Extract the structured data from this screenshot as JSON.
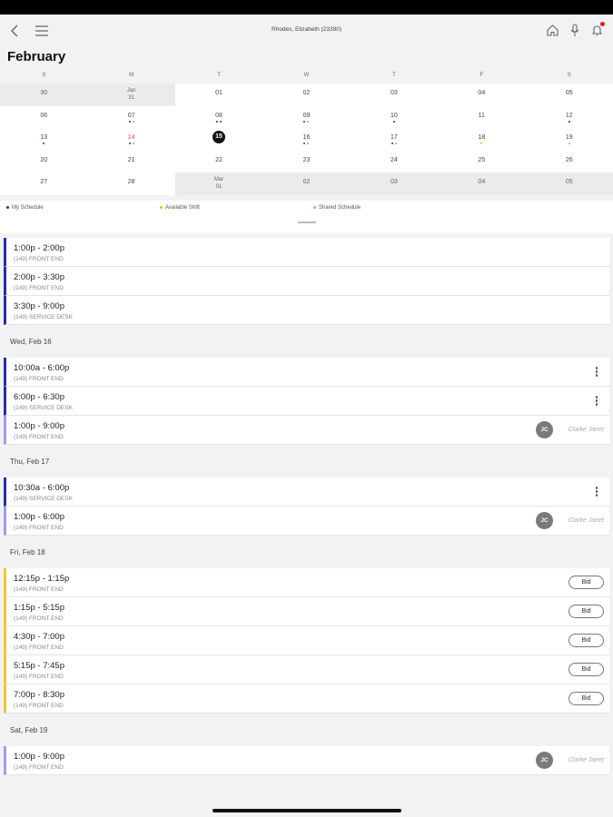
{
  "header": {
    "title": "Rhodes, Elizabeth (23390)"
  },
  "calendar": {
    "month": "February",
    "weekdays": [
      "S",
      "M",
      "T",
      "W",
      "T",
      "F",
      "S"
    ],
    "weeks": [
      [
        {
          "l": "30",
          "m": true
        },
        {
          "l": "Jan",
          "l2": "31",
          "m": true
        },
        {
          "l": "01"
        },
        {
          "l": "02"
        },
        {
          "l": "03"
        },
        {
          "l": "04"
        },
        {
          "l": "05"
        }
      ],
      [
        {
          "l": "06"
        },
        {
          "l": "07",
          "d": [
            "blue",
            "lav"
          ]
        },
        {
          "l": "08",
          "d": [
            "blue",
            "blue"
          ]
        },
        {
          "l": "09",
          "d": [
            "blue",
            "lav"
          ]
        },
        {
          "l": "10",
          "d": [
            "blue"
          ]
        },
        {
          "l": "11"
        },
        {
          "l": "12",
          "d": [
            "blue"
          ]
        }
      ],
      [
        {
          "l": "13",
          "d": [
            "blue"
          ]
        },
        {
          "l": "14",
          "red": true,
          "d": [
            "blue",
            "lav"
          ]
        },
        {
          "l": "15",
          "today": true
        },
        {
          "l": "16",
          "d": [
            "blue",
            "lav"
          ]
        },
        {
          "l": "17",
          "d": [
            "blue",
            "lav"
          ]
        },
        {
          "l": "18",
          "d": [
            "yel"
          ]
        },
        {
          "l": "19",
          "d": [
            "lav"
          ]
        }
      ],
      [
        {
          "l": "20"
        },
        {
          "l": "21"
        },
        {
          "l": "22"
        },
        {
          "l": "23"
        },
        {
          "l": "24"
        },
        {
          "l": "25"
        },
        {
          "l": "26"
        }
      ],
      [
        {
          "l": "27"
        },
        {
          "l": "28"
        },
        {
          "l": "Mar",
          "l2": "01",
          "m": true
        },
        {
          "l": "02",
          "m": true
        },
        {
          "l": "03",
          "m": true
        },
        {
          "l": "04",
          "m": true
        },
        {
          "l": "05",
          "m": true
        }
      ]
    ]
  },
  "legend": {
    "my_schedule": "My Schedule",
    "available_shift": "Available Shift",
    "shared_schedule": "Shared Schedule"
  },
  "schedule": [
    {
      "type": "card",
      "time": "1:00p - 2:00p",
      "loc": "(149) FRONT END",
      "color": "blue"
    },
    {
      "type": "card",
      "time": "2:00p - 3:30p",
      "loc": "(149) FRONT END",
      "color": "blue"
    },
    {
      "type": "card",
      "time": "3:30p - 9:00p",
      "loc": "(149) SERVICE DESK",
      "color": "blue"
    },
    {
      "type": "header",
      "label": "Wed, Feb 16"
    },
    {
      "type": "card",
      "time": "10:00a - 6:00p",
      "loc": "(149) FRONT END",
      "color": "blue",
      "action": "menu"
    },
    {
      "type": "card",
      "time": "6:00p - 6:30p",
      "loc": "(149) SERVICE DESK",
      "color": "blue",
      "action": "menu"
    },
    {
      "type": "card",
      "time": "1:00p - 9:00p",
      "loc": "(149) FRONT END",
      "color": "lav",
      "action": "shared",
      "initials": "JC",
      "name": "Clarke Janet"
    },
    {
      "type": "header",
      "label": "Thu, Feb 17"
    },
    {
      "type": "card",
      "time": "10:30a - 6:00p",
      "loc": "(149) SERVICE DESK",
      "color": "blue",
      "action": "menu"
    },
    {
      "type": "card",
      "time": "1:00p - 6:00p",
      "loc": "(149) FRONT END",
      "color": "lav",
      "action": "shared",
      "initials": "JC",
      "name": "Clarke Janet"
    },
    {
      "type": "header",
      "label": "Fri, Feb 18"
    },
    {
      "type": "card",
      "time": "12:15p - 1:15p",
      "loc": "(149) FRONT END",
      "color": "yel",
      "action": "bid",
      "bid": "Bid"
    },
    {
      "type": "card",
      "time": "1:15p - 5:15p",
      "loc": "(149) FRONT END",
      "color": "yel",
      "action": "bid",
      "bid": "Bid"
    },
    {
      "type": "card",
      "time": "4:30p - 7:00p",
      "loc": "(149) FRONT END",
      "color": "yel",
      "action": "bid",
      "bid": "Bid"
    },
    {
      "type": "card",
      "time": "5:15p - 7:45p",
      "loc": "(149) FRONT END",
      "color": "yel",
      "action": "bid",
      "bid": "Bid"
    },
    {
      "type": "card",
      "time": "7:00p - 8:30p",
      "loc": "(149) FRONT END",
      "color": "yel",
      "action": "bid",
      "bid": "Bid"
    },
    {
      "type": "header",
      "label": "Sat, Feb 19"
    },
    {
      "type": "card",
      "time": "1:00p - 9:00p",
      "loc": "(149) FRONT END",
      "color": "lav",
      "action": "shared",
      "initials": "JC",
      "name": "Clarke Janet"
    }
  ],
  "colors": {
    "my_schedule": "#2a2aa6",
    "available_shift": "#f4c430",
    "shared_schedule": "#9f9fe0"
  }
}
